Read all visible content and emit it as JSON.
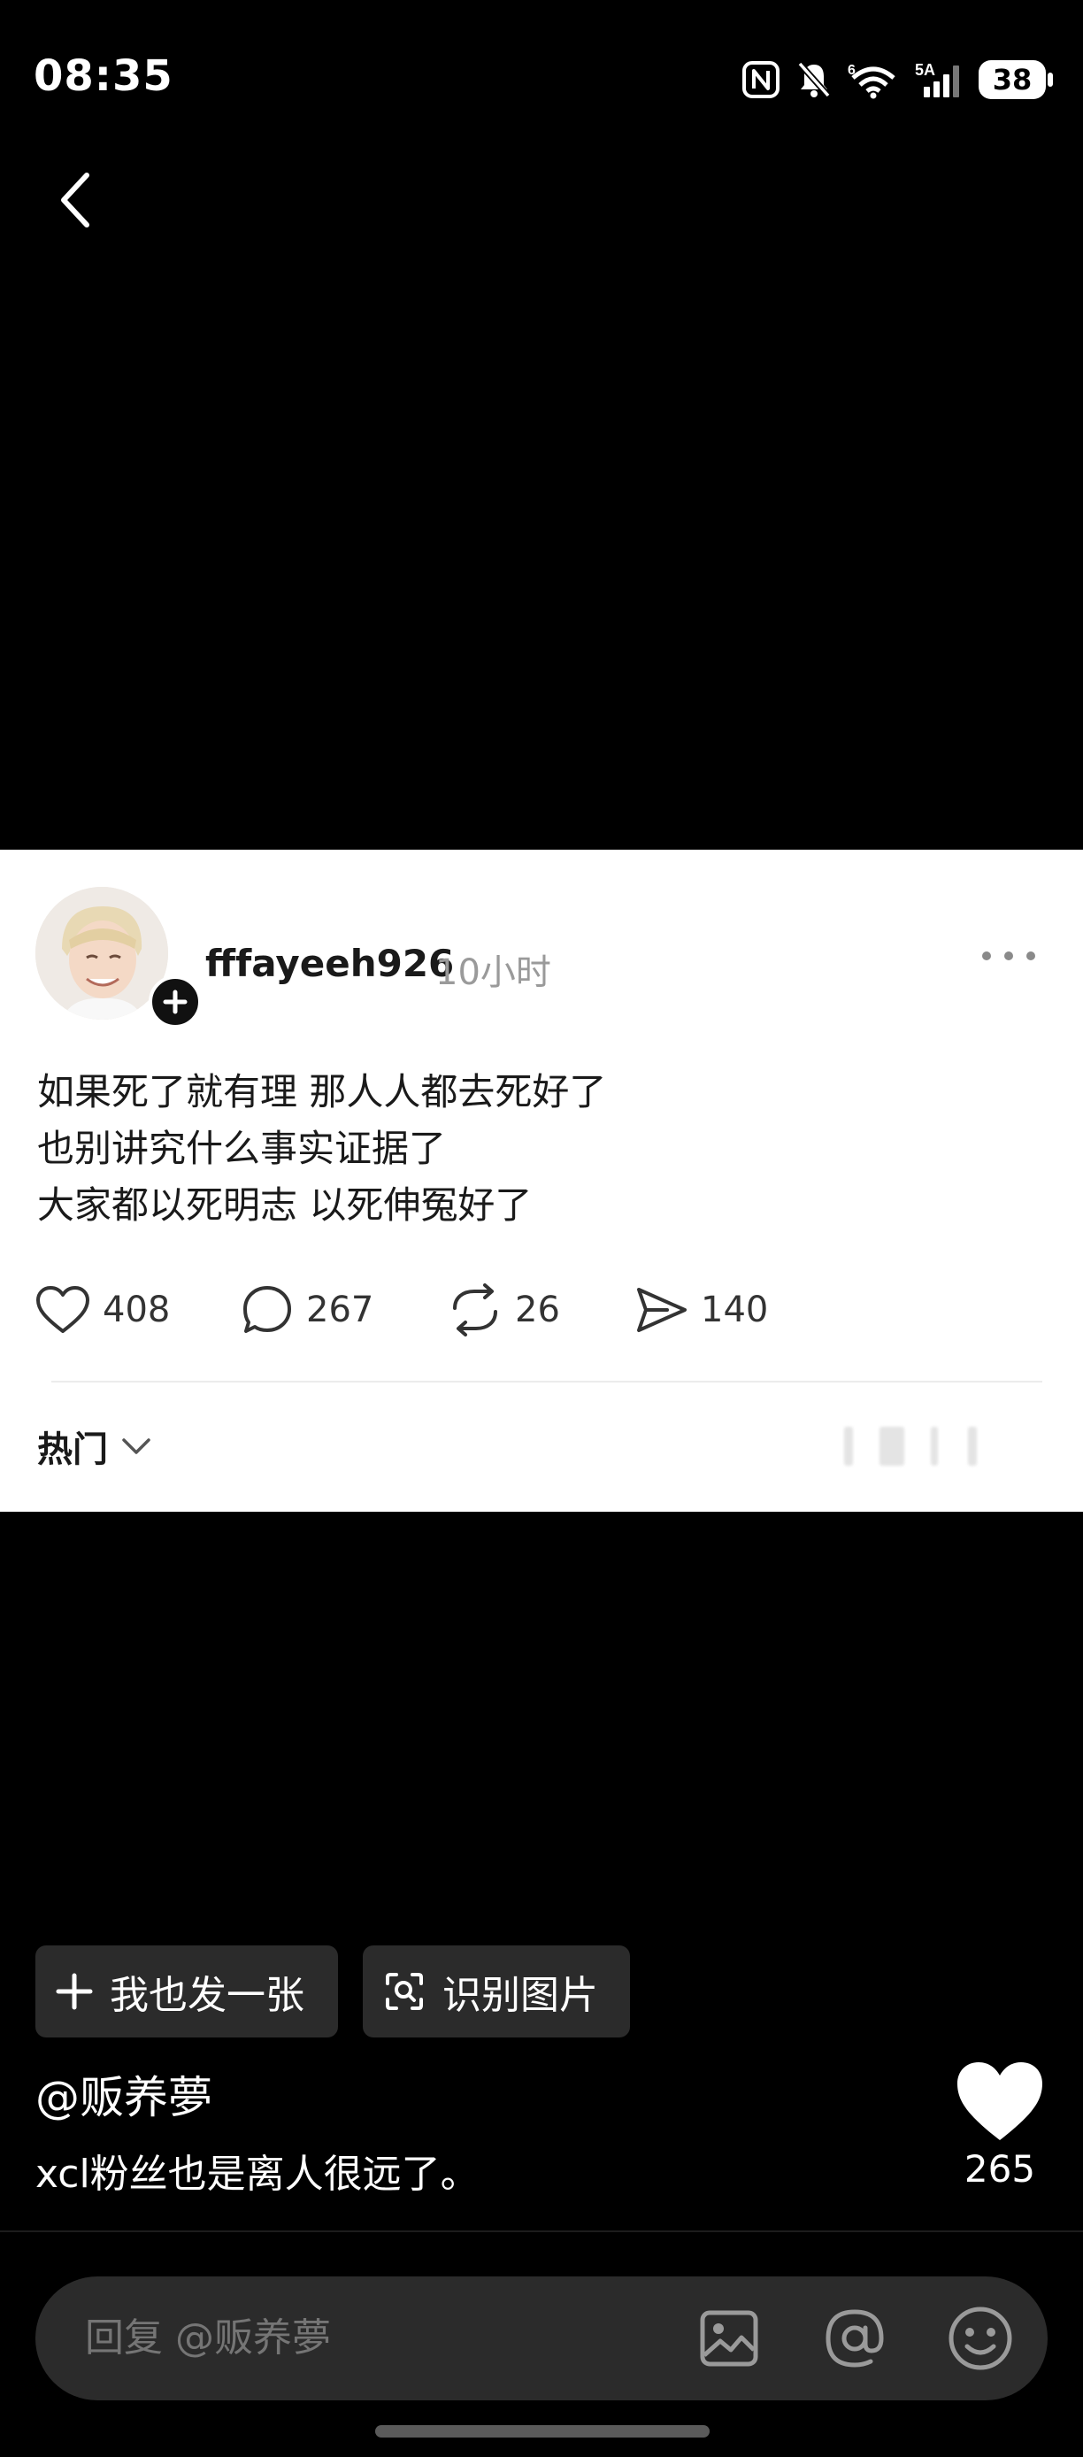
{
  "status_bar": {
    "time": "08:35",
    "signal_label": "5A",
    "wifi_label": "6",
    "battery": "38"
  },
  "post": {
    "username": "fffayeeh926",
    "time_ago": "10小时",
    "lines": [
      "如果死了就有理 那人人都去死好了",
      "也别讲究什么事实证据了",
      "大家都以死明志 以死伸冤好了"
    ],
    "likes": "408",
    "comments": "267",
    "reposts": "26",
    "shares": "140",
    "sort_label": "热门"
  },
  "actions": {
    "post_same": "我也发一张",
    "recognize": "识别图片"
  },
  "comment": {
    "author": "@贩养夢",
    "text": "xcl粉丝也是离人很远了。",
    "like_count": "265"
  },
  "reply": {
    "placeholder": "回复 @贩养夢"
  },
  "icons": [
    "back-arrow-icon",
    "nfc-icon",
    "mute-bell-icon",
    "wifi-icon",
    "signal-icon",
    "battery-icon",
    "heart-icon",
    "comment-icon",
    "repost-icon",
    "share-icon",
    "chevron-down-icon",
    "plus-icon",
    "scan-icon",
    "image-icon",
    "at-icon",
    "emoji-icon"
  ],
  "colors": {
    "background": "#000000",
    "card": "#ffffff",
    "pill": "#2b2b2b"
  }
}
